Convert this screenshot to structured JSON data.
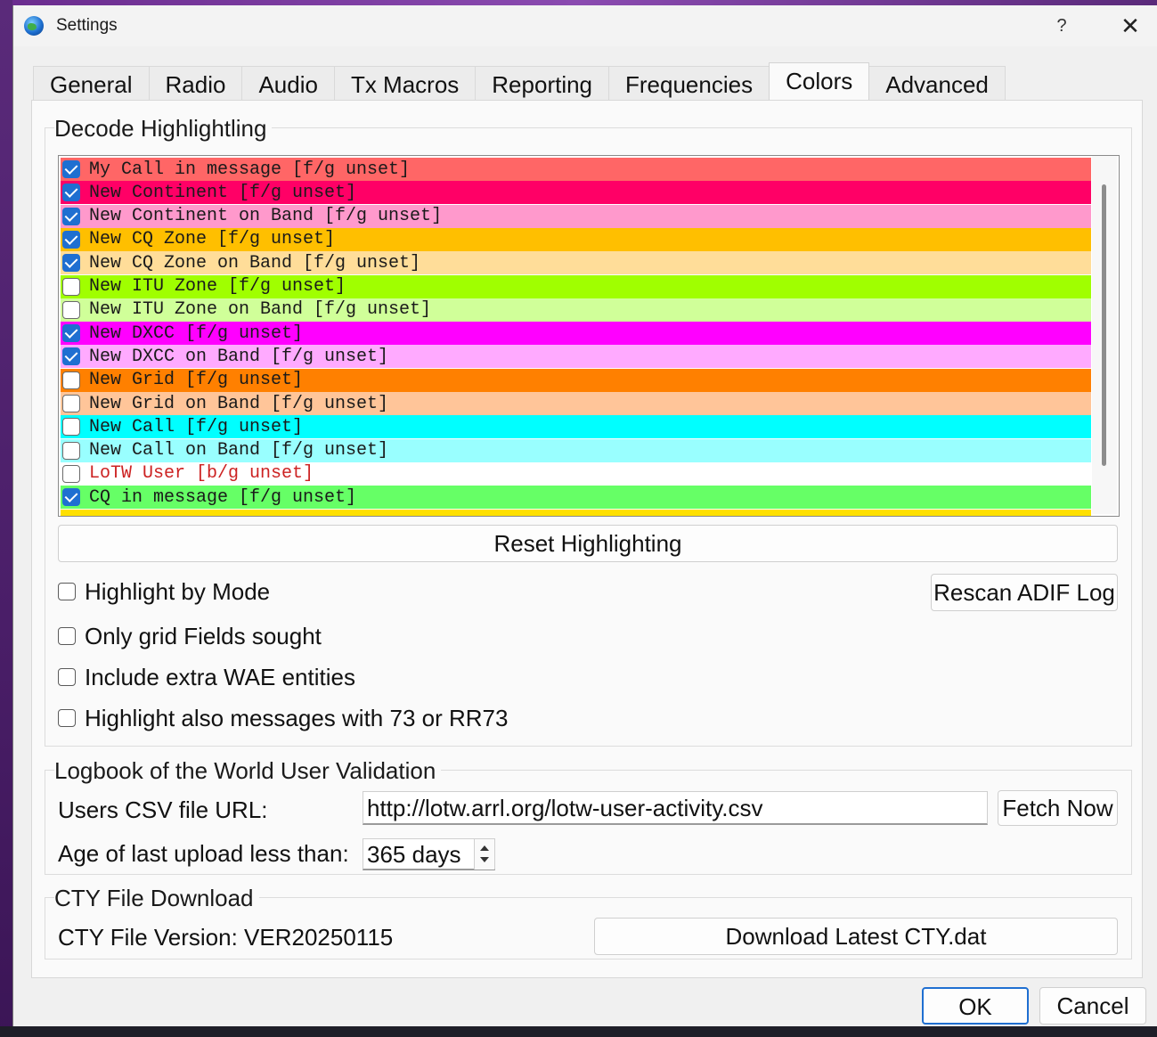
{
  "window": {
    "title": "Settings",
    "help_label": "?",
    "close_label": "✕"
  },
  "tabs": [
    {
      "label": "General"
    },
    {
      "label": "Radio"
    },
    {
      "label": "Audio"
    },
    {
      "label": "Tx Macros"
    },
    {
      "label": "Reporting"
    },
    {
      "label": "Frequencies"
    },
    {
      "label": "Colors",
      "active": true
    },
    {
      "label": "Advanced"
    }
  ],
  "decode_highlighting": {
    "group_title": "Decode Highlightling",
    "items": [
      {
        "label": "My Call in message [f/g unset]",
        "checked": true,
        "bg": "#ff6666",
        "fg": "#1a1a1a"
      },
      {
        "label": "New Continent [f/g unset]",
        "checked": true,
        "bg": "#ff0066",
        "fg": "#1a1a1a"
      },
      {
        "label": "New Continent on Band [f/g unset]",
        "checked": true,
        "bg": "#ff99cc",
        "fg": "#1a1a1a"
      },
      {
        "label": "New CQ Zone [f/g unset]",
        "checked": true,
        "bg": "#ffbf00",
        "fg": "#1a1a1a"
      },
      {
        "label": "New CQ Zone on Band [f/g unset]",
        "checked": true,
        "bg": "#ffdd99",
        "fg": "#1a1a1a"
      },
      {
        "label": "New ITU Zone [f/g unset]",
        "checked": false,
        "bg": "#a0ff00",
        "fg": "#1a1a1a"
      },
      {
        "label": "New ITU Zone on Band [f/g unset]",
        "checked": false,
        "bg": "#d0ff99",
        "fg": "#1a1a1a"
      },
      {
        "label": "New DXCC [f/g unset]",
        "checked": true,
        "bg": "#ff00ff",
        "fg": "#1a1a1a"
      },
      {
        "label": "New DXCC on Band [f/g unset]",
        "checked": true,
        "bg": "#ffaaff",
        "fg": "#1a1a1a"
      },
      {
        "label": "New Grid [f/g unset]",
        "checked": false,
        "bg": "#ff8000",
        "fg": "#1a1a1a"
      },
      {
        "label": "New Grid on Band [f/g unset]",
        "checked": false,
        "bg": "#ffc599",
        "fg": "#1a1a1a"
      },
      {
        "label": "New Call [f/g unset]",
        "checked": false,
        "bg": "#00ffff",
        "fg": "#1a1a1a"
      },
      {
        "label": "New Call on Band [f/g unset]",
        "checked": false,
        "bg": "#99ffff",
        "fg": "#1a1a1a"
      },
      {
        "label": "LoTW User [b/g unset]",
        "checked": false,
        "bg": "#ffffff",
        "fg": "#cc2222"
      },
      {
        "label": "CQ in message [f/g unset]",
        "checked": true,
        "bg": "#66ff66",
        "fg": "#1a1a1a"
      }
    ],
    "partial_next_row_bg": "#ffe000",
    "reset_label": "Reset Highlighting",
    "rescan_label": "Rescan ADIF Log",
    "options": [
      {
        "label": "Highlight by Mode",
        "checked": false
      },
      {
        "label": "Only grid Fields sought",
        "checked": false
      },
      {
        "label": "Include extra WAE entities",
        "checked": false
      },
      {
        "label": "Highlight also messages with 73 or RR73",
        "checked": false
      }
    ]
  },
  "lotw": {
    "group_title": "Logbook of the World User Validation",
    "url_label": "Users CSV file URL:",
    "url_value": "http://lotw.arrl.org/lotw-user-activity.csv",
    "fetch_label": "Fetch Now",
    "age_label": "Age of last upload less than:",
    "age_value": "365 days"
  },
  "cty": {
    "group_title": "CTY File Download",
    "version_label": "CTY File Version: VER20250115",
    "download_label": "Download Latest CTY.dat"
  },
  "footer": {
    "ok_label": "OK",
    "cancel_label": "Cancel"
  },
  "accent_color": "#1f6fd1"
}
